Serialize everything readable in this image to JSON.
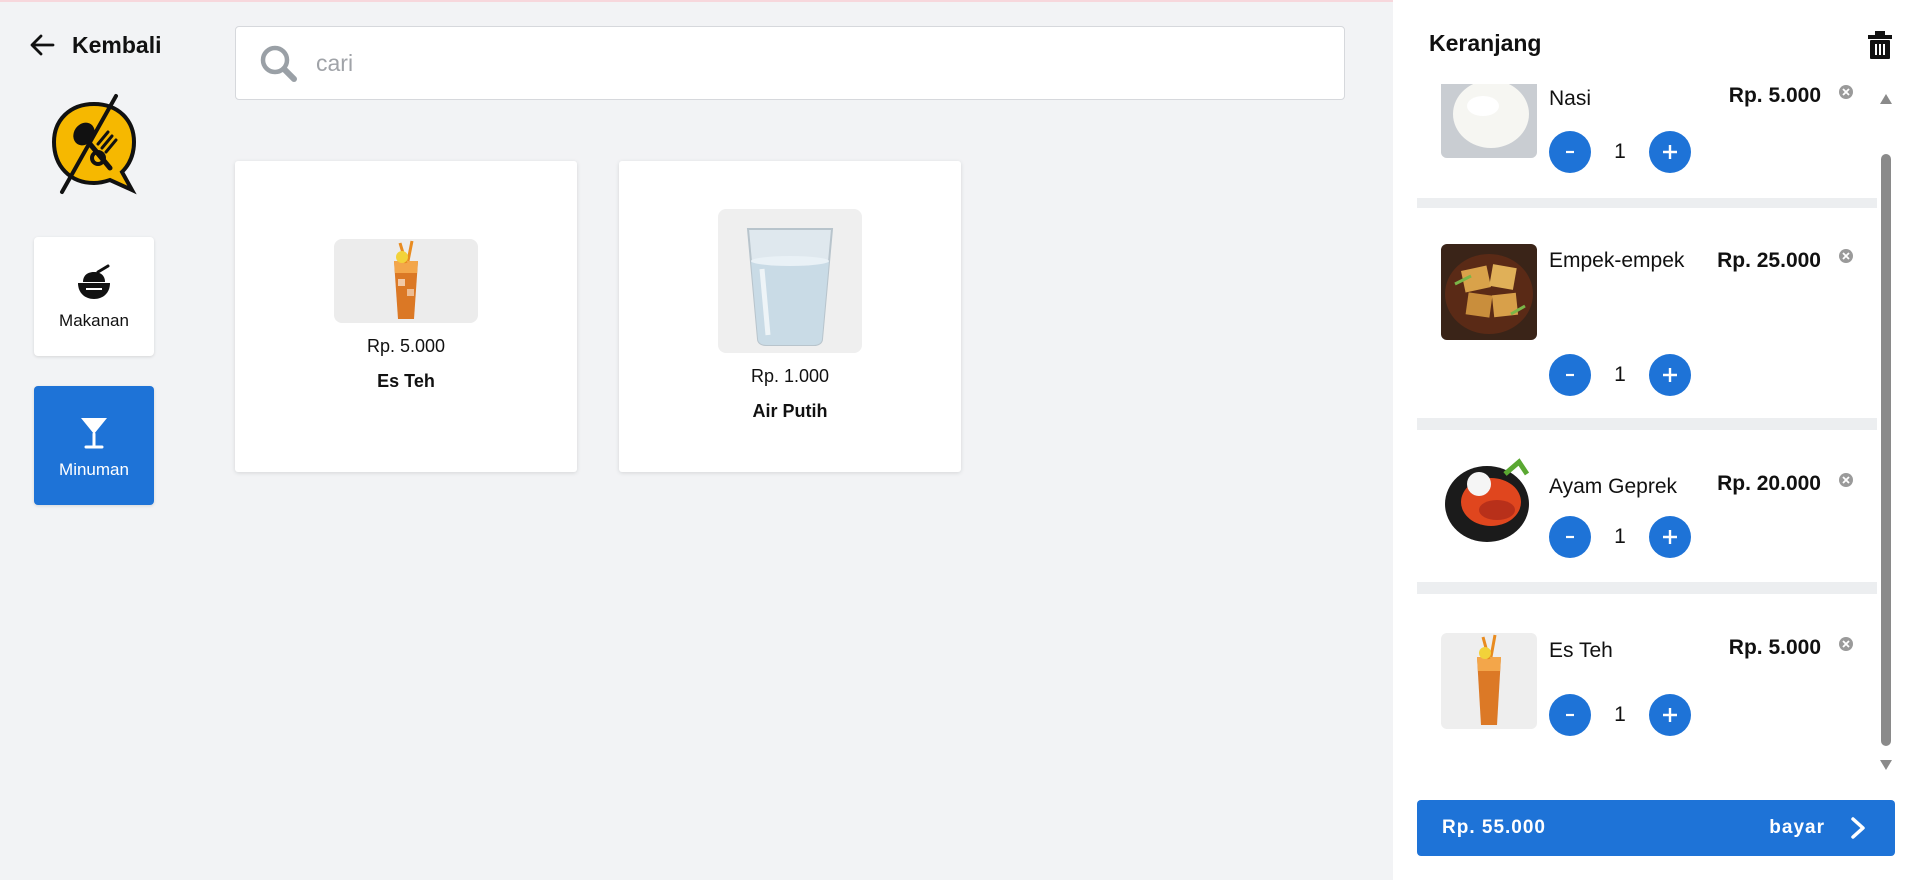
{
  "nav": {
    "back_label": "Kembali",
    "categories": [
      {
        "label": "Makanan",
        "icon": "food-bowl-icon",
        "active": false
      },
      {
        "label": "Minuman",
        "icon": "cocktail-glass-icon",
        "active": true
      }
    ]
  },
  "search": {
    "placeholder": "cari",
    "value": "",
    "icon": "search-icon"
  },
  "products": [
    {
      "price": "Rp. 5.000",
      "name": "Es Teh"
    },
    {
      "price": "Rp. 1.000",
      "name": "Air Putih"
    }
  ],
  "cart": {
    "title": "Keranjang",
    "items": [
      {
        "name": "Nasi",
        "price": "Rp. 5.000",
        "qty": "1"
      },
      {
        "name": "Empek-empek",
        "price": "Rp. 25.000",
        "qty": "1"
      },
      {
        "name": "Ayam Geprek",
        "price": "Rp. 20.000",
        "qty": "1"
      },
      {
        "name": "Es Teh",
        "price": "Rp. 5.000",
        "qty": "1"
      }
    ],
    "total": "Rp. 55.000",
    "pay_label": "bayar"
  },
  "colors": {
    "accent": "#1e73d7",
    "background": "#f2f3f5",
    "logo_yellow": "#f6b800"
  }
}
